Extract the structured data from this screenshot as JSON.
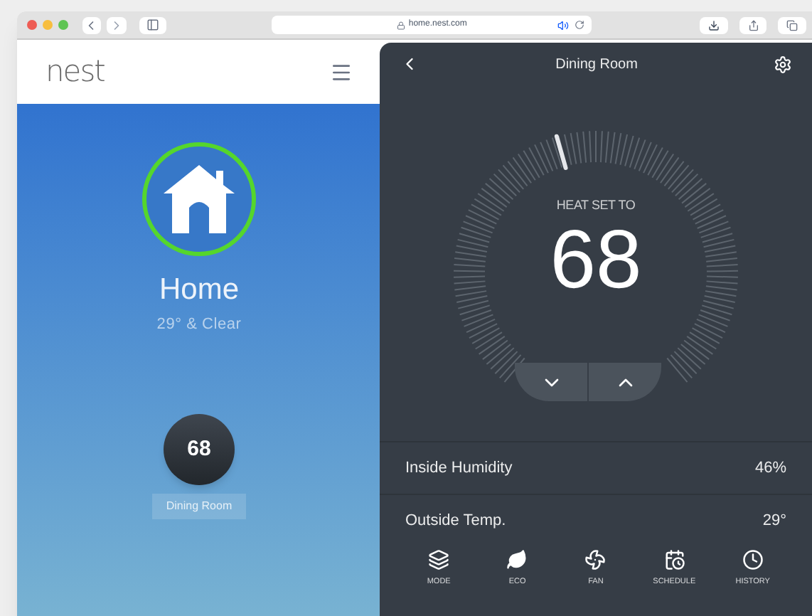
{
  "browser": {
    "url": "home.nest.com"
  },
  "page": {
    "logo": "nest",
    "home": {
      "title": "Home",
      "weather": "29° & Clear"
    },
    "thermostat": {
      "temperature": "68",
      "name": "Dining Room"
    }
  },
  "panel": {
    "title": "Dining Room",
    "mode_label": "HEAT SET TO",
    "setpoint": "68",
    "rows": [
      {
        "label": "Inside Humidity",
        "value": "46%"
      },
      {
        "label": "Outside Temp.",
        "value": "29°"
      }
    ],
    "nav": [
      {
        "kind": "mode",
        "label": "MODE"
      },
      {
        "kind": "eco",
        "label": "ECO"
      },
      {
        "kind": "fan",
        "label": "FAN"
      },
      {
        "kind": "schedule",
        "label": "SCHEDULE"
      },
      {
        "kind": "history",
        "label": "HISTORY"
      }
    ]
  }
}
